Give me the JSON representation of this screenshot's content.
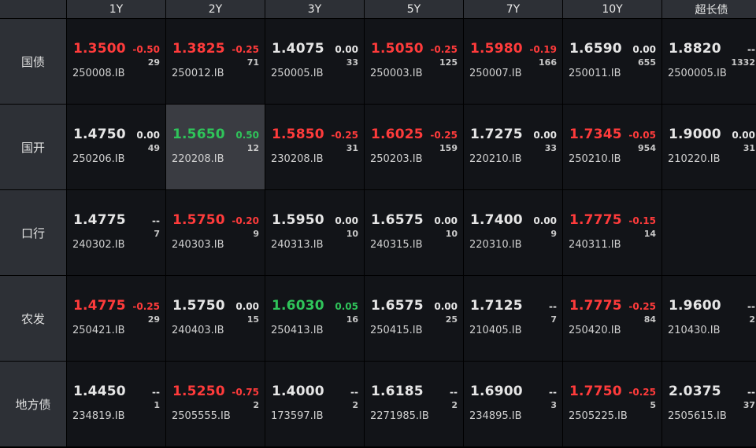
{
  "columns": [
    "1Y",
    "2Y",
    "3Y",
    "5Y",
    "7Y",
    "10Y",
    "超长债"
  ],
  "colors": {
    "up": "#ff3b3b",
    "down": "#2fc45a",
    "flat": "#e6e6e6"
  },
  "rows": [
    {
      "label": "国债",
      "cells": [
        {
          "price": "1.3500",
          "change": "-0.50",
          "volume": "29",
          "code": "250008.IB",
          "color": "red"
        },
        {
          "price": "1.3825",
          "change": "-0.25",
          "volume": "71",
          "code": "250012.IB",
          "color": "red"
        },
        {
          "price": "1.4075",
          "change": "0.00",
          "volume": "33",
          "code": "250005.IB",
          "color": "white"
        },
        {
          "price": "1.5050",
          "change": "-0.25",
          "volume": "125",
          "code": "250003.IB",
          "color": "red"
        },
        {
          "price": "1.5980",
          "change": "-0.19",
          "volume": "166",
          "code": "250007.IB",
          "color": "red"
        },
        {
          "price": "1.6590",
          "change": "0.00",
          "volume": "655",
          "code": "250011.IB",
          "color": "white"
        },
        {
          "price": "1.8820",
          "change": "--",
          "volume": "1332",
          "code": "2500005.IB",
          "color": "white"
        }
      ]
    },
    {
      "label": "国开",
      "cells": [
        {
          "price": "1.4750",
          "change": "0.00",
          "volume": "49",
          "code": "250206.IB",
          "color": "white"
        },
        {
          "price": "1.5650",
          "change": "0.50",
          "volume": "12",
          "code": "220208.IB",
          "color": "green",
          "selected": true
        },
        {
          "price": "1.5850",
          "change": "-0.25",
          "volume": "31",
          "code": "230208.IB",
          "color": "red"
        },
        {
          "price": "1.6025",
          "change": "-0.25",
          "volume": "159",
          "code": "250203.IB",
          "color": "red"
        },
        {
          "price": "1.7275",
          "change": "0.00",
          "volume": "33",
          "code": "220210.IB",
          "color": "white"
        },
        {
          "price": "1.7345",
          "change": "-0.05",
          "volume": "954",
          "code": "250210.IB",
          "color": "red"
        },
        {
          "price": "1.9000",
          "change": "0.00",
          "volume": "31",
          "code": "210220.IB",
          "color": "white"
        }
      ]
    },
    {
      "label": "口行",
      "cells": [
        {
          "price": "1.4775",
          "change": "--",
          "volume": "7",
          "code": "240302.IB",
          "color": "white"
        },
        {
          "price": "1.5750",
          "change": "-0.20",
          "volume": "9",
          "code": "240303.IB",
          "color": "red"
        },
        {
          "price": "1.5950",
          "change": "0.00",
          "volume": "10",
          "code": "240313.IB",
          "color": "white"
        },
        {
          "price": "1.6575",
          "change": "0.00",
          "volume": "10",
          "code": "240315.IB",
          "color": "white"
        },
        {
          "price": "1.7400",
          "change": "0.00",
          "volume": "9",
          "code": "220310.IB",
          "color": "white"
        },
        {
          "price": "1.7775",
          "change": "-0.15",
          "volume": "14",
          "code": "240311.IB",
          "color": "red"
        },
        null
      ]
    },
    {
      "label": "农发",
      "cells": [
        {
          "price": "1.4775",
          "change": "-0.25",
          "volume": "29",
          "code": "250421.IB",
          "color": "red"
        },
        {
          "price": "1.5750",
          "change": "0.00",
          "volume": "15",
          "code": "240403.IB",
          "color": "white"
        },
        {
          "price": "1.6030",
          "change": "0.05",
          "volume": "16",
          "code": "250413.IB",
          "color": "green"
        },
        {
          "price": "1.6575",
          "change": "0.00",
          "volume": "25",
          "code": "250415.IB",
          "color": "white"
        },
        {
          "price": "1.7125",
          "change": "--",
          "volume": "7",
          "code": "210405.IB",
          "color": "white"
        },
        {
          "price": "1.7775",
          "change": "-0.25",
          "volume": "84",
          "code": "250420.IB",
          "color": "red"
        },
        {
          "price": "1.9600",
          "change": "--",
          "volume": "2",
          "code": "210430.IB",
          "color": "white"
        }
      ]
    },
    {
      "label": "地方债",
      "cells": [
        {
          "price": "1.4450",
          "change": "--",
          "volume": "1",
          "code": "234819.IB",
          "color": "white"
        },
        {
          "price": "1.5250",
          "change": "-0.75",
          "volume": "2",
          "code": "2505555.IB",
          "color": "red"
        },
        {
          "price": "1.4000",
          "change": "--",
          "volume": "2",
          "code": "173597.IB",
          "color": "white"
        },
        {
          "price": "1.6185",
          "change": "--",
          "volume": "2",
          "code": "2271985.IB",
          "color": "white"
        },
        {
          "price": "1.6900",
          "change": "--",
          "volume": "3",
          "code": "234895.IB",
          "color": "white"
        },
        {
          "price": "1.7750",
          "change": "-0.25",
          "volume": "5",
          "code": "2505225.IB",
          "color": "red"
        },
        {
          "price": "2.0375",
          "change": "--",
          "volume": "37",
          "code": "2505615.IB",
          "color": "white"
        }
      ]
    }
  ]
}
